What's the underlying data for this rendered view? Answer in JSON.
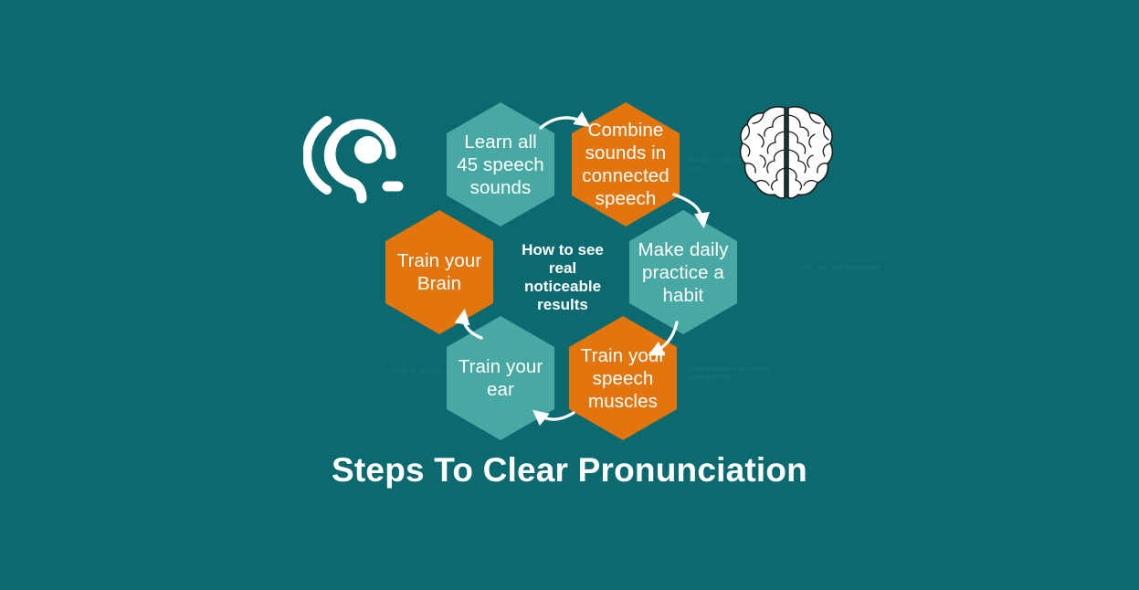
{
  "background_color": "#0b6a70",
  "palette": {
    "teal_hex": "#48a8a3",
    "orange_hex": "#e2750d",
    "background": "#0b6a70",
    "text": "#ffffff",
    "faint_note": "#18767b"
  },
  "title": "Steps To Clear Pronunciation",
  "center": {
    "text": "How to see\nreal\nnoticeable\nresults"
  },
  "steps": [
    {
      "id": "learn-sounds",
      "label": "Learn all\n45 speech\nsounds",
      "color": "teal"
    },
    {
      "id": "combine-sounds",
      "label": "Combine\nsounds in\nconnected\nspeech",
      "color": "orange"
    },
    {
      "id": "daily-practice",
      "label": "Make daily\npractice a\nhabit",
      "color": "teal"
    },
    {
      "id": "speech-muscles",
      "label": "Train your\nspeech\nmuscles",
      "color": "orange"
    },
    {
      "id": "train-ear",
      "label": "Train your\near",
      "color": "teal"
    },
    {
      "id": "train-brain",
      "label": "Train your\nBrain",
      "color": "orange"
    }
  ],
  "icons": {
    "ear": "ear-hearing-icon",
    "brain": "brain-icon"
  },
  "notes": [
    {
      "id": "brain-note",
      "text": "Illustrate a step by step"
    },
    {
      "id": "viral-note",
      "text": "Go viral, high engagement"
    },
    {
      "id": "tutorials-note",
      "text": "Great for tutorials"
    },
    {
      "id": "context-note",
      "text": "Contextualizes your content,\ngrabs attention"
    }
  ]
}
